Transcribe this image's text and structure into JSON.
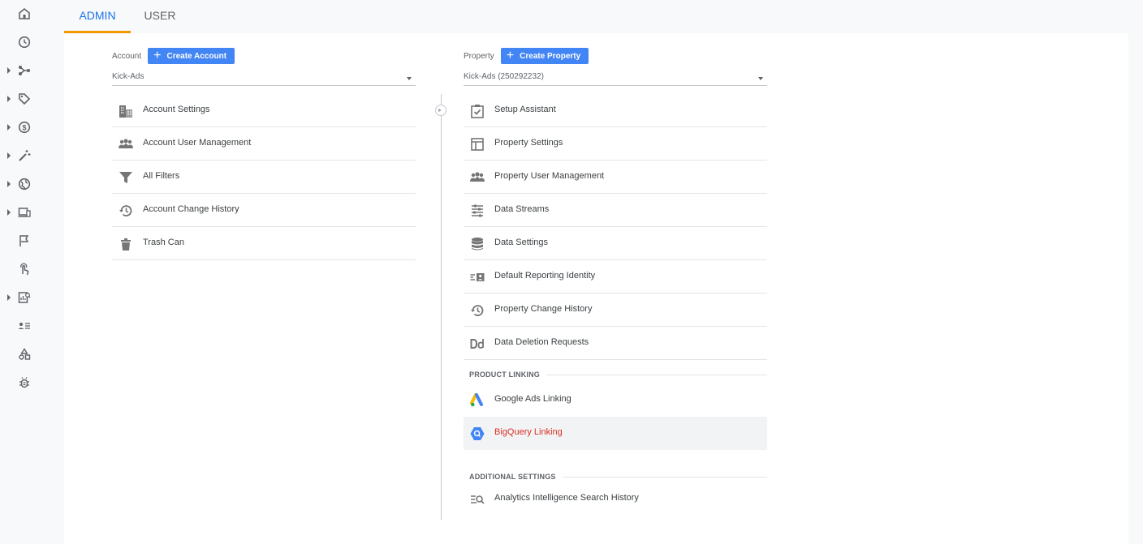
{
  "tabs": {
    "admin": "ADMIN",
    "user": "USER"
  },
  "rail": [
    {
      "icon": "home-icon",
      "caret": false
    },
    {
      "icon": "clock-icon",
      "caret": false
    },
    {
      "icon": "flow-icon",
      "caret": true
    },
    {
      "icon": "tag-icon",
      "caret": true
    },
    {
      "icon": "dollar-icon",
      "caret": true
    },
    {
      "icon": "magic-wand-icon",
      "caret": true
    },
    {
      "icon": "globe-icon",
      "caret": true
    },
    {
      "icon": "devices-icon",
      "caret": true
    },
    {
      "icon": "flag-icon",
      "caret": false
    },
    {
      "icon": "touch-icon",
      "caret": false
    },
    {
      "icon": "report-search-icon",
      "caret": true
    },
    {
      "icon": "user-list-icon",
      "caret": false
    },
    {
      "icon": "shapes-icon",
      "caret": false
    },
    {
      "icon": "bug-icon",
      "caret": false
    }
  ],
  "account": {
    "label": "Account",
    "create_label": "Create Account",
    "selected": "Kick-Ads",
    "items": [
      {
        "label": "Account Settings",
        "icon": "building-icon"
      },
      {
        "label": "Account User Management",
        "icon": "people-icon"
      },
      {
        "label": "All Filters",
        "icon": "filter-icon"
      },
      {
        "label": "Account Change History",
        "icon": "history-icon"
      },
      {
        "label": "Trash Can",
        "icon": "trash-icon"
      }
    ]
  },
  "property": {
    "label": "Property",
    "create_label": "Create Property",
    "selected": "Kick-Ads (250292232)",
    "items": [
      {
        "label": "Setup Assistant",
        "icon": "checklist-icon"
      },
      {
        "label": "Property Settings",
        "icon": "layout-icon"
      },
      {
        "label": "Property User Management",
        "icon": "people-icon"
      },
      {
        "label": "Data Streams",
        "icon": "streams-icon"
      },
      {
        "label": "Data Settings",
        "icon": "database-icon"
      },
      {
        "label": "Default Reporting Identity",
        "icon": "identity-icon"
      },
      {
        "label": "Property Change History",
        "icon": "history-icon"
      },
      {
        "label": "Data Deletion Requests",
        "icon": "dd-icon"
      }
    ],
    "product_linking": {
      "header": "PRODUCT LINKING",
      "items": [
        {
          "label": "Google Ads Linking",
          "icon": "google-ads-icon"
        },
        {
          "label": "BigQuery Linking",
          "icon": "bigquery-icon"
        }
      ]
    },
    "additional_settings": {
      "header": "ADDITIONAL SETTINGS",
      "items": [
        {
          "label": "Analytics Intelligence Search History",
          "icon": "search-history-icon"
        }
      ]
    }
  },
  "colors": {
    "accent": "#1a73e8",
    "tab_underline": "#f29900",
    "button": "#4285f4",
    "active_link": "#d93025"
  }
}
